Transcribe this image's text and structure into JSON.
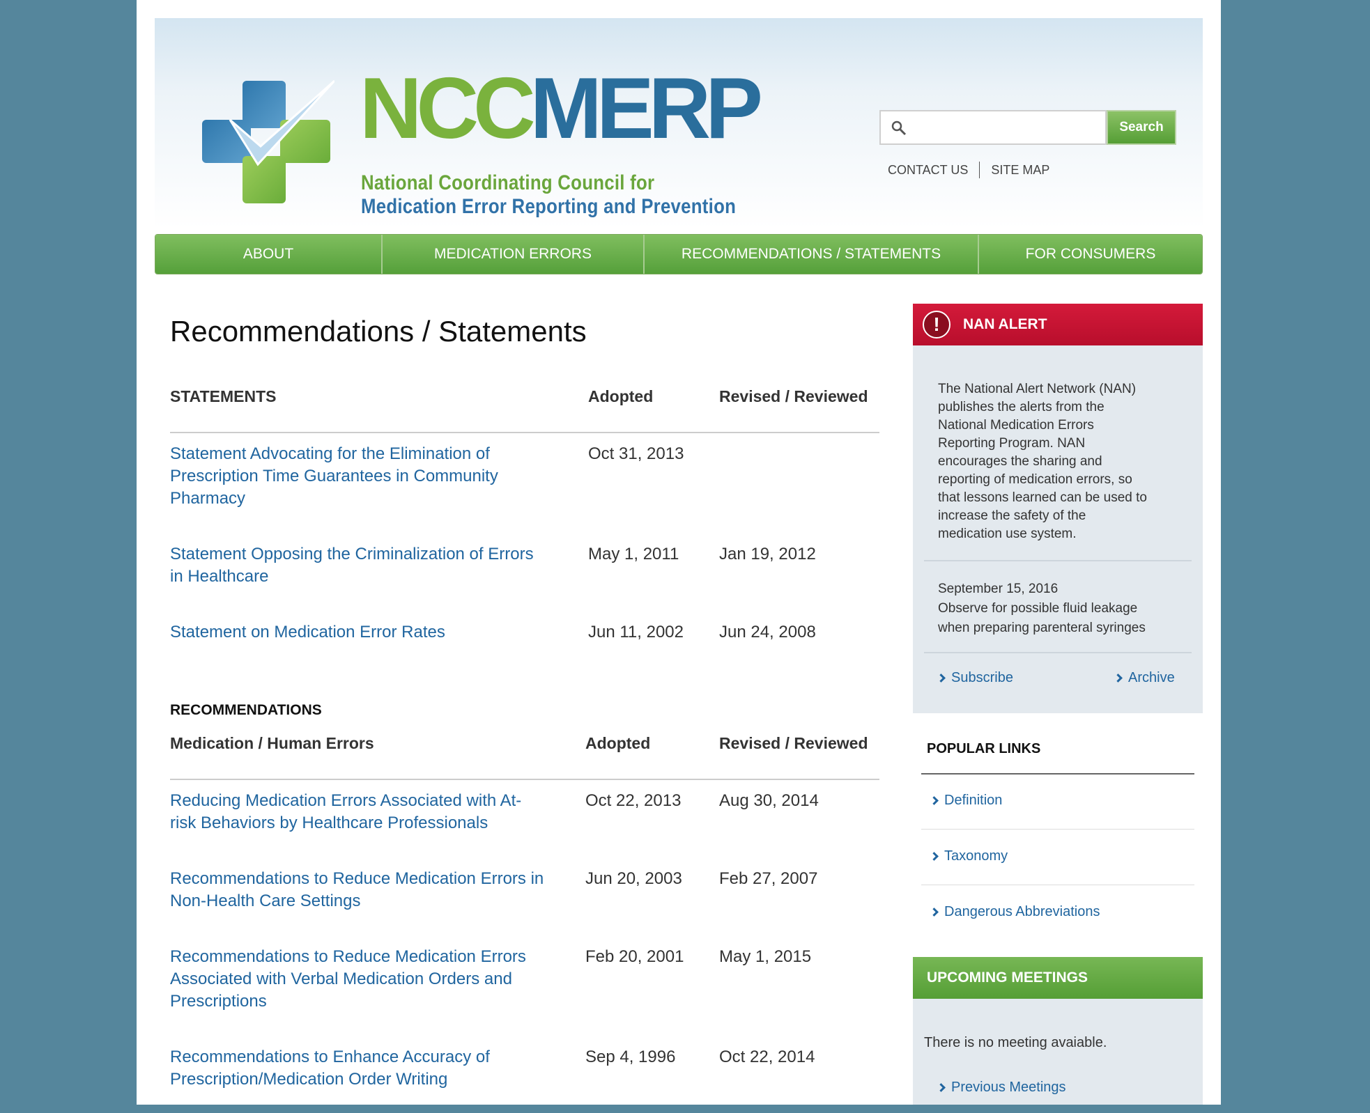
{
  "header": {
    "logo_ncc": "NCC",
    "logo_merp": "MERP",
    "logo_line1": "National Coordinating Council for",
    "logo_line2": "Medication Error Reporting and Prevention",
    "search_button": "Search",
    "search_value": "",
    "contact_us": "CONTACT US",
    "site_map": "SITE MAP"
  },
  "nav": {
    "items": [
      {
        "label": "ABOUT"
      },
      {
        "label": "MEDICATION ERRORS"
      },
      {
        "label": "RECOMMENDATIONS / STATEMENTS"
      },
      {
        "label": "FOR CONSUMERS"
      }
    ]
  },
  "main": {
    "title": "Recommendations / Statements",
    "statements": {
      "heading": "STATEMENTS",
      "col_adopted": "Adopted",
      "col_revised": "Revised / Reviewed",
      "rows": [
        {
          "line1": "Statement Advocating for the Elimination of",
          "line2": "Prescription Time Guarantees in Community",
          "line3": "Pharmacy",
          "adopted": "Oct 31, 2013",
          "revised": ""
        },
        {
          "line1": "Statement Opposing the Criminalization of Errors",
          "line2": "in Healthcare",
          "adopted": "May 1, 2011",
          "revised": "Jan 19, 2012"
        },
        {
          "line1": "Statement on Medication Error Rates",
          "adopted": "Jun 11, 2002",
          "revised": "Jun 24, 2008"
        }
      ]
    },
    "recommendations": {
      "label": "RECOMMENDATIONS",
      "heading": "Medication / Human Errors",
      "col_adopted": "Adopted",
      "col_revised": "Revised / Reviewed",
      "rows": [
        {
          "line1": "Reducing Medication Errors Associated with At-",
          "line2": "risk Behaviors by Healthcare Professionals",
          "adopted": "Oct 22, 2013",
          "revised": "Aug 30, 2014"
        },
        {
          "line1": "Recommendations to Reduce Medication Errors in",
          "line2": "Non-Health Care Settings",
          "adopted": "Jun 20, 2003",
          "revised": "Feb 27, 2007"
        },
        {
          "line1": "Recommendations to Reduce Medication Errors",
          "line2": "Associated with Verbal Medication Orders and",
          "line3": "Prescriptions",
          "adopted": "Feb 20, 2001",
          "revised": "May 1, 2015"
        },
        {
          "line1": "Recommendations to Enhance Accuracy of",
          "line2": "Prescription/Medication Order Writing",
          "adopted": "Sep 4, 1996",
          "revised": "Oct 22, 2014"
        }
      ]
    }
  },
  "sidebar": {
    "nan": {
      "icon": "!",
      "title": "NAN ALERT",
      "lines": [
        "The National Alert Network (NAN)",
        "publishes the alerts from the",
        "National Medication Errors",
        "Reporting Program. NAN",
        "encourages the sharing and",
        "reporting of medication errors, so",
        "that lessons learned can be used to",
        "increase the safety of the",
        "medication use system."
      ],
      "news_date": "September 15, 2016",
      "news_line1": "Observe for possible fluid leakage",
      "news_line2": "when preparing parenteral syringes",
      "subscribe": "Subscribe",
      "archive": "Archive"
    },
    "popular": {
      "title": "POPULAR LINKS",
      "items": [
        "Definition",
        "Taxonomy",
        "Dangerous Abbreviations"
      ]
    },
    "meetings": {
      "title": "UPCOMING MEETINGS",
      "text": "There is no meeting avaiable.",
      "link": "Previous Meetings"
    }
  },
  "colors": {
    "background": "#55869c",
    "green": "#5ca23d",
    "blue_link": "#20659f",
    "alert_red": "#c8142f"
  }
}
